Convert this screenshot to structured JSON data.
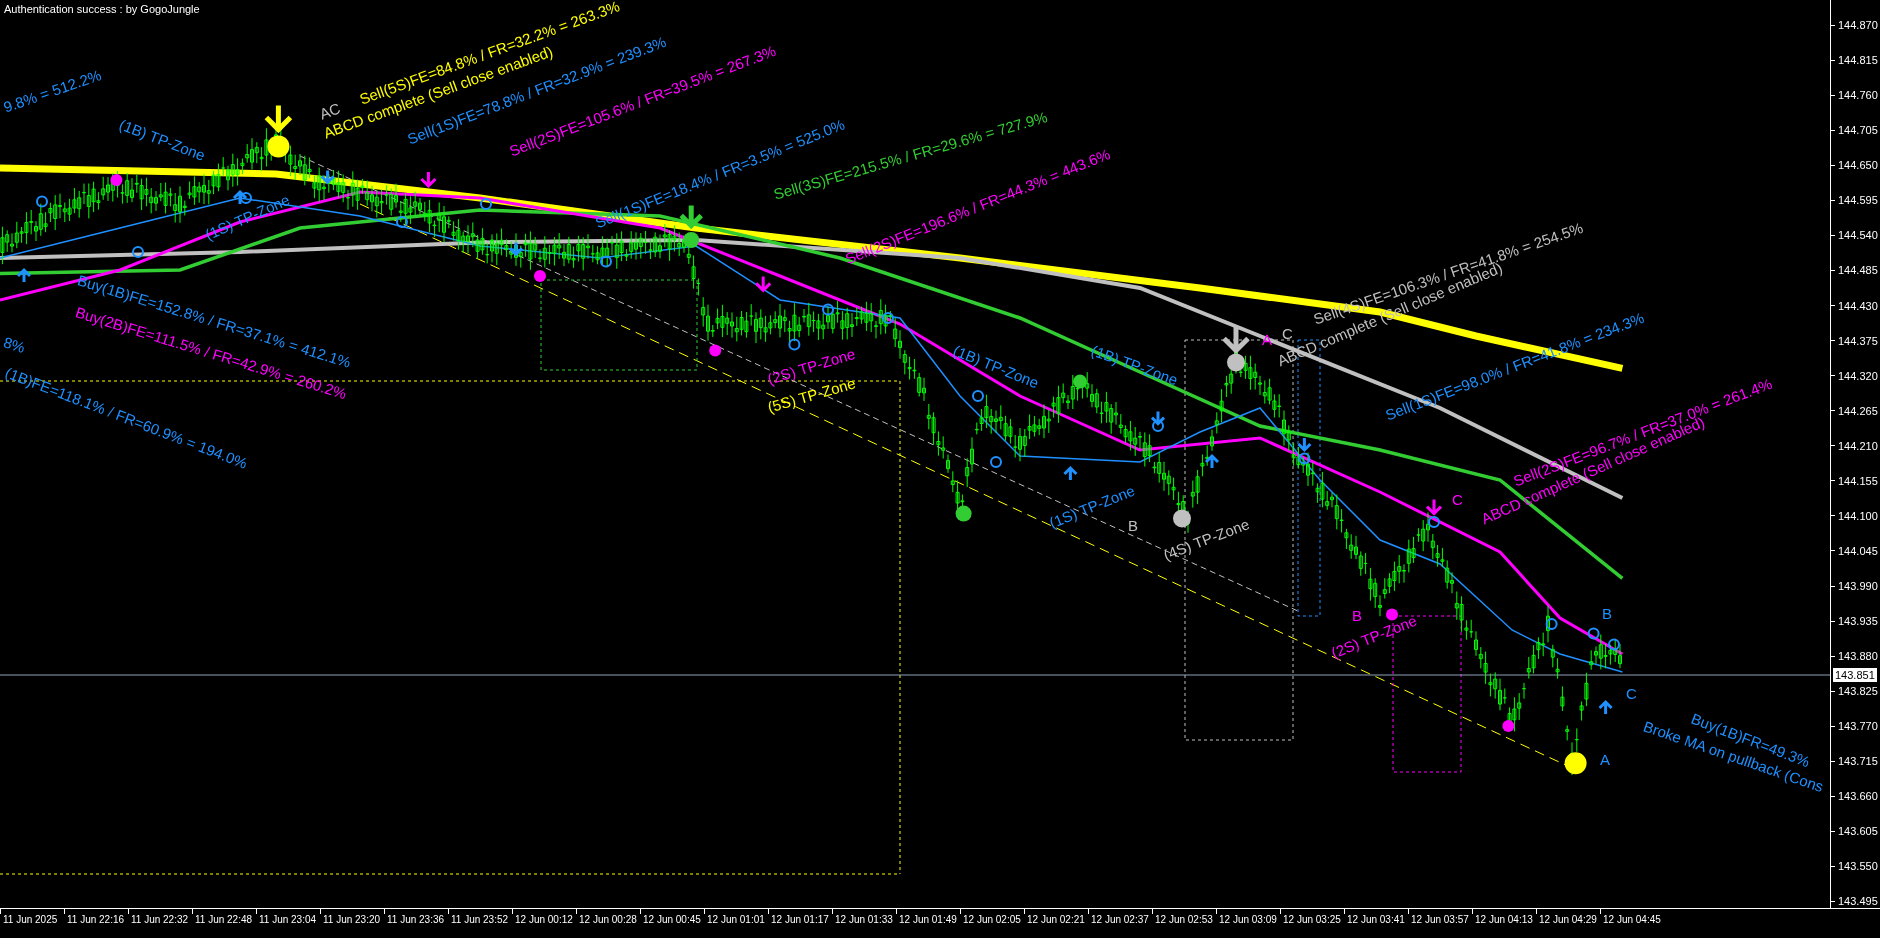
{
  "header": {
    "title": "Authentication success : by GogoJungle"
  },
  "chart": {
    "annotations": [
      {
        "text": "9.8% = 512.2%",
        "color": "#1e90ff"
      },
      {
        "text": "(1B) TP-Zone",
        "color": "#1e90ff"
      },
      {
        "text": "Sell(5S)FE=84.8% / FR=32.2% = 263.3%",
        "color": "#ffff00"
      },
      {
        "text": "AC",
        "color": "#c0c0c0"
      },
      {
        "text": "ABCD complete (Sell close enabled)",
        "color": "#ffff00"
      },
      {
        "text": "Sell(1S)FE=78.8% / FR=32.9% = 239.3%",
        "color": "#1e90ff"
      },
      {
        "text": "Sell(2S)FE=105.6% / FR=39.5% = 267.3%",
        "color": "#ff00ff"
      },
      {
        "text": "Sell(1S)FE=18.4% / FR=3.5% = 525.0%",
        "color": "#1e90ff"
      },
      {
        "text": "Sell(3S)FE=215.5% / FR=29.6% = 727.9%",
        "color": "#32cd32"
      },
      {
        "text": "Sell(2S)FE=196.6% / FR=44.3% = 443.6%",
        "color": "#ff00ff"
      },
      {
        "text": "(1S) TP-Zone",
        "color": "#1e90ff"
      },
      {
        "text": "Buy(1B)FE=152.8% / FR=37.1% = 412.1%",
        "color": "#1e90ff"
      },
      {
        "text": "Buy(2B)FE=111.5% / FR=42.9% = 260.2%",
        "color": "#ff00ff"
      },
      {
        "text": "(1B)FE=118.1% / FR=60.9% = 194.0%",
        "color": "#1e90ff"
      },
      {
        "text": "8%",
        "color": "#1e90ff"
      },
      {
        "text": "(2S) TP-Zone",
        "color": "#ff00ff"
      },
      {
        "text": "(5S) TP-Zone",
        "color": "#ffff00"
      },
      {
        "text": "(1B) TP-Zone",
        "color": "#1e90ff"
      },
      {
        "text": "(1B) TP-Zone",
        "color": "#1e90ff"
      },
      {
        "text": "Sell(4S)FE=106.3% / FR=41.8% = 254.5%",
        "color": "#c0c0c0"
      },
      {
        "text": "ABCD complete (Sell close enabled)",
        "color": "#c0c0c0"
      },
      {
        "text": "Sell(1S)FE=98.0% / FR=41.8% = 234.3%",
        "color": "#1e90ff"
      },
      {
        "text": "Sell(2S)FE=96.7% / FR=37.0% = 261.4%",
        "color": "#ff00ff"
      },
      {
        "text": "ABCD complete (Sell close enabled)",
        "color": "#ff00ff"
      },
      {
        "text": "C",
        "color": "#ff00ff"
      },
      {
        "text": "(1S) TP-Zone",
        "color": "#1e90ff"
      },
      {
        "text": "B",
        "color": "#c0c0c0"
      },
      {
        "text": "(4S) TP-Zone",
        "color": "#c0c0c0"
      },
      {
        "text": "(2S) TP-Zone",
        "color": "#ff00ff"
      },
      {
        "text": "B",
        "color": "#ff00ff"
      },
      {
        "text": "B",
        "color": "#1e90ff"
      },
      {
        "text": "C",
        "color": "#1e90ff"
      },
      {
        "text": "Buy(1B)FR=49.3%",
        "color": "#1e90ff"
      },
      {
        "text": "Broke MA on pullback (Cons",
        "color": "#1e90ff"
      },
      {
        "text": "A",
        "color": "#1e90ff"
      },
      {
        "text": "A",
        "color": "#ff00ff"
      },
      {
        "text": "C",
        "color": "#c0c0c0"
      }
    ]
  },
  "price_axis": {
    "labels": [
      "144.870",
      "144.815",
      "144.760",
      "144.705",
      "144.650",
      "144.595",
      "144.540",
      "144.485",
      "144.430",
      "144.375",
      "144.320",
      "144.265",
      "144.210",
      "144.155",
      "144.100",
      "144.045",
      "143.990",
      "143.935",
      "143.880",
      "143.825",
      "143.770",
      "143.715",
      "143.660",
      "143.605",
      "143.550",
      "143.495"
    ],
    "current_price": "143.851"
  },
  "time_axis": {
    "labels": [
      "11 Jun 2025",
      "11 Jun 22:16",
      "11 Jun 22:32",
      "11 Jun 22:48",
      "11 Jun 23:04",
      "11 Jun 23:20",
      "11 Jun 23:36",
      "11 Jun 23:52",
      "12 Jun 00:12",
      "12 Jun 00:28",
      "12 Jun 00:45",
      "12 Jun 01:01",
      "12 Jun 01:17",
      "12 Jun 01:33",
      "12 Jun 01:49",
      "12 Jun 02:05",
      "12 Jun 02:21",
      "12 Jun 02:37",
      "12 Jun 02:53",
      "12 Jun 03:09",
      "12 Jun 03:25",
      "12 Jun 03:41",
      "12 Jun 03:57",
      "12 Jun 04:13",
      "12 Jun 04:29",
      "12 Jun 04:45"
    ]
  }
}
